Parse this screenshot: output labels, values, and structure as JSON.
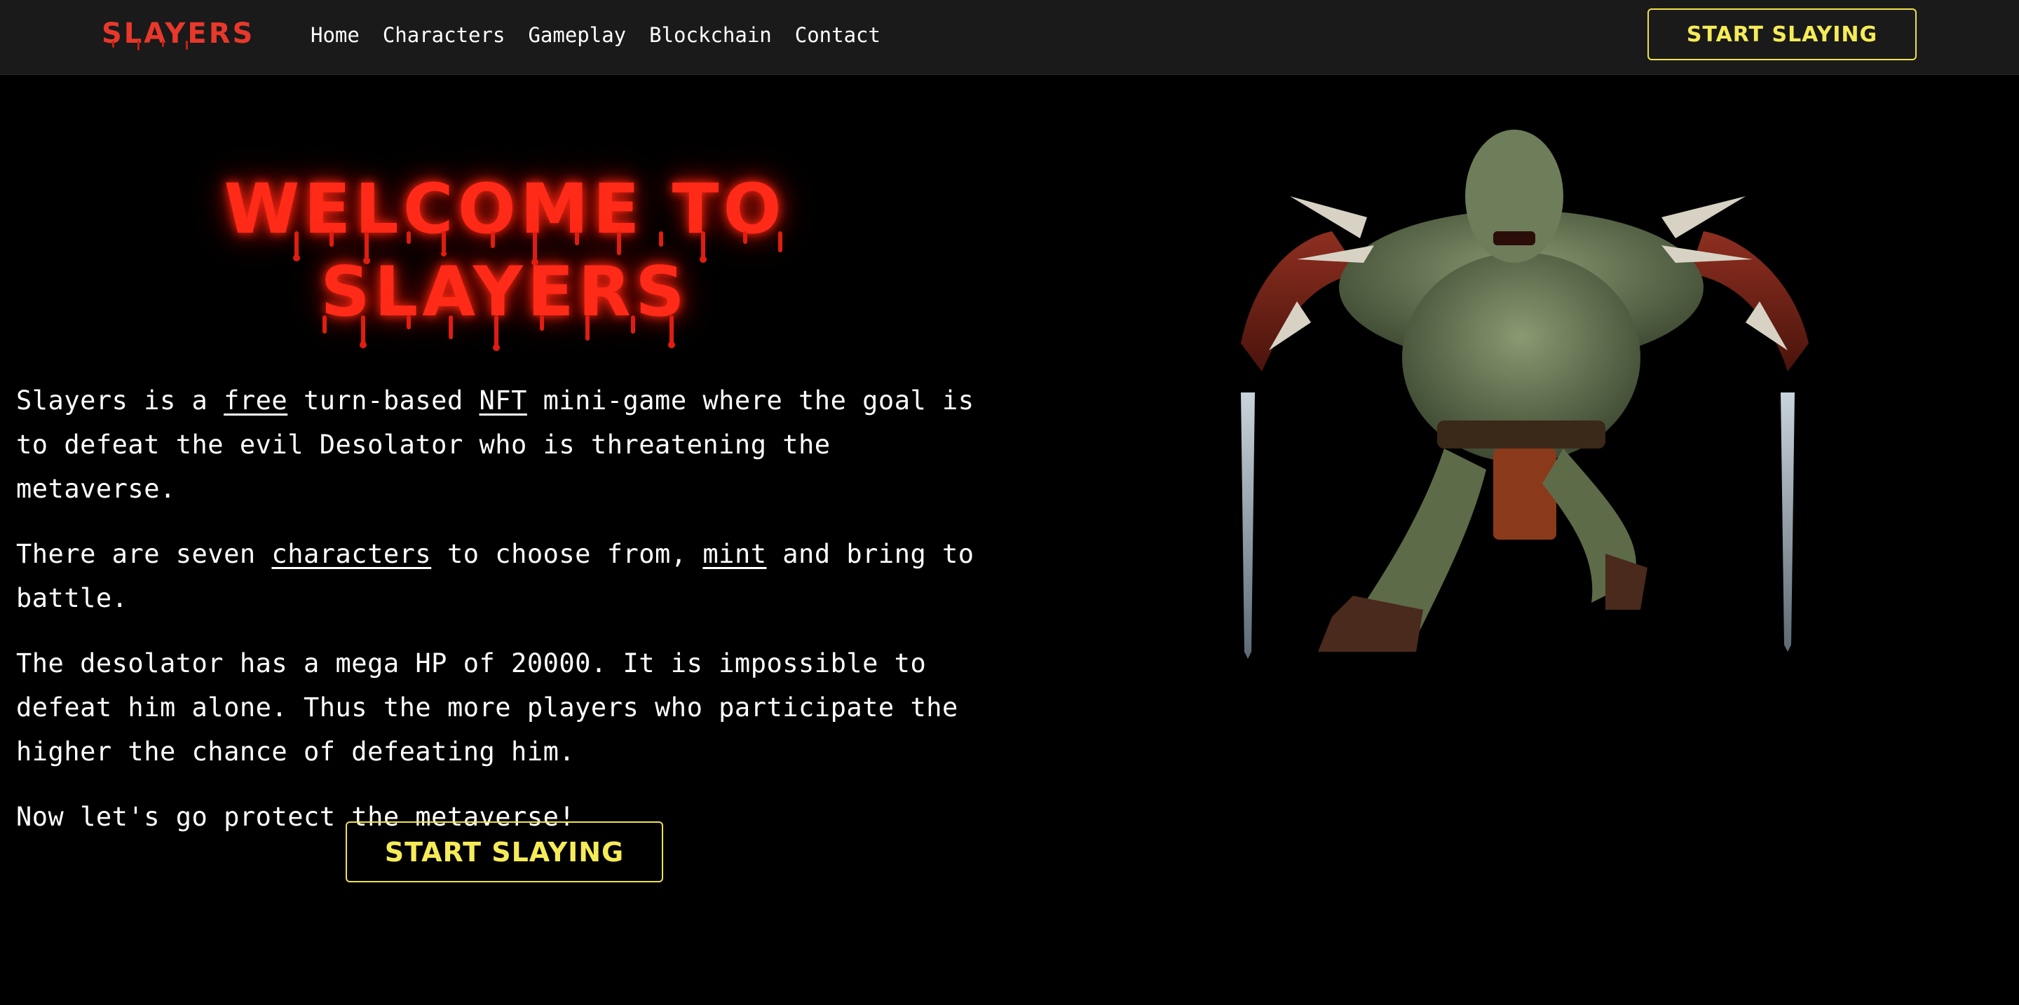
{
  "nav": {
    "brand": "SLAYERS",
    "links": [
      "Home",
      "Characters",
      "Gameplay",
      "Blockchain",
      "Contact"
    ],
    "cta_label": "START SLAYING"
  },
  "hero": {
    "title_line1": "WELCOME TO",
    "title_line2": "SLAYERS",
    "p1_a": "Slayers is a ",
    "p1_link1": "free",
    "p1_b": " turn-based ",
    "p1_link2": "NFT",
    "p1_c": " mini-game where the goal is to defeat the evil Desolator who is threatening the metaverse.",
    "p2_a": "There are seven ",
    "p2_link1": "characters",
    "p2_b": " to choose from, ",
    "p2_link2": "mint",
    "p2_c": " and bring to battle.",
    "p3": "The desolator has a mega HP of 20000. It is impossible to defeat him alone. Thus the more players who participate the higher the chance of defeating him.",
    "p4": "Now let's go protect the metaverse!",
    "cta_label": "START SLAYING"
  },
  "colors": {
    "brand_red": "#e8382b",
    "accent_yellow": "#f0e14a",
    "navbar_bg": "#1a1a1a",
    "page_bg": "#000000"
  }
}
